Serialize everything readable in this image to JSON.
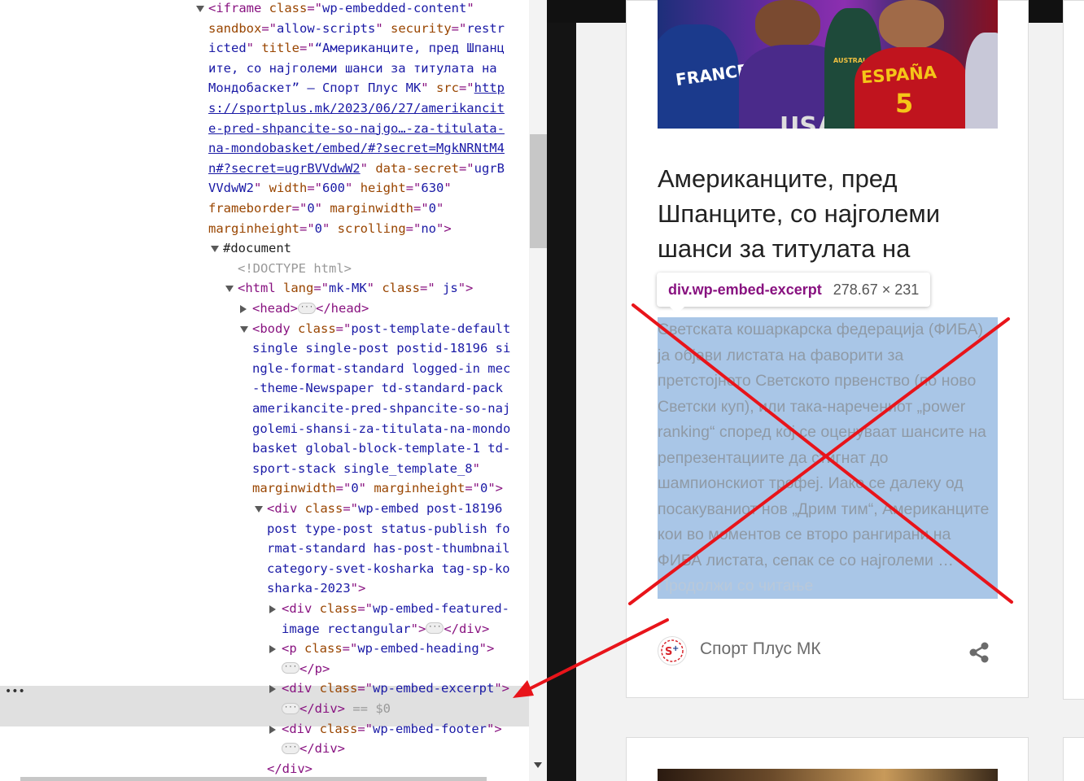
{
  "devtools": {
    "lines": [
      {
        "indent": 256,
        "tri": "down",
        "parts": [
          [
            "tag",
            "<iframe "
          ],
          [
            "an",
            "class"
          ],
          [
            "tag",
            "=\""
          ],
          [
            "av",
            "wp-embedded-content"
          ],
          [
            "tag",
            "\""
          ]
        ]
      },
      {
        "indent": 256,
        "parts": [
          [
            "an",
            "sandbox"
          ],
          [
            "tag",
            "=\""
          ],
          [
            "av",
            "allow-scripts"
          ],
          [
            "tag",
            "\" "
          ],
          [
            "an",
            "security"
          ],
          [
            "tag",
            "=\""
          ],
          [
            "av",
            "restr"
          ]
        ]
      },
      {
        "indent": 256,
        "parts": [
          [
            "av",
            "icted"
          ],
          [
            "tag",
            "\" "
          ],
          [
            "an",
            "title"
          ],
          [
            "tag",
            "=\""
          ],
          [
            "av",
            "“Американците, пред Шпанц"
          ]
        ]
      },
      {
        "indent": 256,
        "parts": [
          [
            "av",
            "ите, со најголеми шанси за титулата на"
          ]
        ]
      },
      {
        "indent": 256,
        "parts": [
          [
            "av",
            "Мондобаскет” — Спорт Плус МК"
          ],
          [
            "tag",
            "\" "
          ],
          [
            "an",
            "src"
          ],
          [
            "tag",
            "=\""
          ],
          [
            "link",
            "http"
          ]
        ]
      },
      {
        "indent": 256,
        "parts": [
          [
            "link",
            "s://sportplus.mk/2023/06/27/amerikancit"
          ]
        ]
      },
      {
        "indent": 256,
        "parts": [
          [
            "link",
            "e-pred-shpancite-so-najgo…-za-titulata-"
          ]
        ]
      },
      {
        "indent": 256,
        "parts": [
          [
            "link",
            "na-mondobasket/embed/#?secret=MgkNRNtM4"
          ]
        ]
      },
      {
        "indent": 256,
        "parts": [
          [
            "link",
            "n#?secret=ugrBVVdwW2"
          ],
          [
            "tag",
            "\" "
          ],
          [
            "an",
            "data-secret"
          ],
          [
            "tag",
            "=\""
          ],
          [
            "av",
            "ugrB"
          ]
        ]
      },
      {
        "indent": 256,
        "parts": [
          [
            "av",
            "VVdwW2"
          ],
          [
            "tag",
            "\" "
          ],
          [
            "an",
            "width"
          ],
          [
            "tag",
            "=\""
          ],
          [
            "av",
            "600"
          ],
          [
            "tag",
            "\" "
          ],
          [
            "an",
            "height"
          ],
          [
            "tag",
            "=\""
          ],
          [
            "av",
            "630"
          ],
          [
            "tag",
            "\""
          ]
        ]
      },
      {
        "indent": 256,
        "parts": [
          [
            "an",
            "frameborder"
          ],
          [
            "tag",
            "=\""
          ],
          [
            "av",
            "0"
          ],
          [
            "tag",
            "\" "
          ],
          [
            "an",
            "marginwidth"
          ],
          [
            "tag",
            "=\""
          ],
          [
            "av",
            "0"
          ],
          [
            "tag",
            "\""
          ]
        ]
      },
      {
        "indent": 256,
        "parts": [
          [
            "an",
            "marginheight"
          ],
          [
            "tag",
            "=\""
          ],
          [
            "av",
            "0"
          ],
          [
            "tag",
            "\" "
          ],
          [
            "an",
            "scrolling"
          ],
          [
            "tag",
            "=\""
          ],
          [
            "av",
            "no"
          ],
          [
            "tag",
            "\">"
          ]
        ]
      },
      {
        "indent": 274,
        "tri": "down",
        "parts": [
          [
            "plain",
            "#document"
          ]
        ]
      },
      {
        "indent": 292,
        "parts": [
          [
            "gray",
            "<!DOCTYPE html>"
          ]
        ]
      },
      {
        "indent": 292,
        "tri": "down",
        "parts": [
          [
            "tag",
            "<html "
          ],
          [
            "an",
            "lang"
          ],
          [
            "tag",
            "=\""
          ],
          [
            "av",
            "mk-MK"
          ],
          [
            "tag",
            "\" "
          ],
          [
            "an",
            "class"
          ],
          [
            "tag",
            "=\""
          ],
          [
            "av",
            " js"
          ],
          [
            "tag",
            "\">"
          ]
        ]
      },
      {
        "indent": 310,
        "tri": "right",
        "parts": [
          [
            "tag",
            "<head>"
          ],
          [
            "ell",
            ""
          ],
          [
            "tag",
            "</head>"
          ]
        ]
      },
      {
        "indent": 310,
        "tri": "down",
        "parts": [
          [
            "tag",
            "<body "
          ],
          [
            "an",
            "class"
          ],
          [
            "tag",
            "=\""
          ],
          [
            "av",
            "post-template-default"
          ]
        ]
      },
      {
        "indent": 310,
        "parts": [
          [
            "av",
            "single single-post postid-18196 si"
          ]
        ]
      },
      {
        "indent": 310,
        "parts": [
          [
            "av",
            "ngle-format-standard logged-in mec"
          ]
        ]
      },
      {
        "indent": 310,
        "parts": [
          [
            "av",
            "-theme-Newspaper td-standard-pack"
          ]
        ]
      },
      {
        "indent": 310,
        "parts": [
          [
            "av",
            "amerikancite-pred-shpancite-so-naj"
          ]
        ]
      },
      {
        "indent": 310,
        "parts": [
          [
            "av",
            "golemi-shansi-za-titulata-na-mondo"
          ]
        ]
      },
      {
        "indent": 310,
        "parts": [
          [
            "av",
            "basket global-block-template-1 td-"
          ]
        ]
      },
      {
        "indent": 310,
        "parts": [
          [
            "av",
            "sport-stack single_template_8"
          ],
          [
            "tag",
            "\""
          ]
        ]
      },
      {
        "indent": 310,
        "parts": [
          [
            "an",
            "marginwidth"
          ],
          [
            "tag",
            "=\""
          ],
          [
            "av",
            "0"
          ],
          [
            "tag",
            "\" "
          ],
          [
            "an",
            "marginheight"
          ],
          [
            "tag",
            "=\""
          ],
          [
            "av",
            "0"
          ],
          [
            "tag",
            "\">"
          ]
        ]
      },
      {
        "indent": 328,
        "tri": "down",
        "parts": [
          [
            "tag",
            "<div "
          ],
          [
            "an",
            "class"
          ],
          [
            "tag",
            "=\""
          ],
          [
            "av",
            "wp-embed post-18196"
          ]
        ]
      },
      {
        "indent": 328,
        "parts": [
          [
            "av",
            "post type-post status-publish fo"
          ]
        ]
      },
      {
        "indent": 328,
        "parts": [
          [
            "av",
            "rmat-standard has-post-thumbnail"
          ]
        ]
      },
      {
        "indent": 328,
        "parts": [
          [
            "av",
            "category-svet-kosharka tag-sp-ko"
          ]
        ]
      },
      {
        "indent": 328,
        "parts": [
          [
            "av",
            "sharka-2023"
          ],
          [
            "tag",
            "\">"
          ]
        ]
      },
      {
        "indent": 346,
        "tri": "right",
        "parts": [
          [
            "tag",
            "<div "
          ],
          [
            "an",
            "class"
          ],
          [
            "tag",
            "=\""
          ],
          [
            "av",
            "wp-embed-featured-"
          ]
        ]
      },
      {
        "indent": 346,
        "parts": [
          [
            "av",
            "image rectangular"
          ],
          [
            "tag",
            "\">"
          ],
          [
            "ell",
            ""
          ],
          [
            "tag",
            "</div>"
          ]
        ]
      },
      {
        "indent": 346,
        "tri": "right",
        "parts": [
          [
            "tag",
            "<p "
          ],
          [
            "an",
            "class"
          ],
          [
            "tag",
            "=\""
          ],
          [
            "av",
            "wp-embed-heading"
          ],
          [
            "tag",
            "\">"
          ]
        ]
      },
      {
        "indent": 346,
        "parts": [
          [
            "ell",
            ""
          ],
          [
            "tag",
            "</p>"
          ]
        ]
      },
      {
        "indent": 346,
        "tri": "right",
        "parts": [
          [
            "tag",
            "<div "
          ],
          [
            "an",
            "class"
          ],
          [
            "tag",
            "=\""
          ],
          [
            "av",
            "wp-embed-excerpt"
          ],
          [
            "tag",
            "\">"
          ]
        ]
      },
      {
        "indent": 346,
        "parts": [
          [
            "ell",
            ""
          ],
          [
            "tag",
            "</div>"
          ],
          [
            "gray",
            " == "
          ],
          [
            "gray",
            "$0"
          ]
        ]
      },
      {
        "indent": 346,
        "tri": "right",
        "parts": [
          [
            "tag",
            "<div "
          ],
          [
            "an",
            "class"
          ],
          [
            "tag",
            "=\""
          ],
          [
            "av",
            "wp-embed-footer"
          ],
          [
            "tag",
            "\">"
          ]
        ]
      },
      {
        "indent": 346,
        "parts": [
          [
            "ell",
            ""
          ],
          [
            "tag",
            "</div>"
          ]
        ]
      },
      {
        "indent": 328,
        "parts": [
          [
            "tag",
            "</div>"
          ]
        ]
      }
    ],
    "selected_dots": "•••"
  },
  "page": {
    "featured_texts": {
      "france": "FRANCE",
      "usa": "USA",
      "australia": "AUSTRALIA",
      "espana": "ESPAÑA",
      "number": "5"
    },
    "headline": "Американците, пред Шпанците, со најголеми шанси за титулата на",
    "excerpt": "Светската кошаркарска федерација (ФИБА) ја објави листата на фаворити за претстојното Светското првенство (по ново Светски куп), или така-наречениот „power ranking“ според кој се оценуваат шансите на репрезентациите да стигнат до шампионскиот трофеј.  Иако се далеку од посакуваниот нов „Дрим тим“, Американците кои во моментов се второ рангирани на ФИБА листата, сепак се со најголеми …",
    "read_more": "Продолжи со читање",
    "site_name": "Спорт Плус МК",
    "tooltip": {
      "selector": "div.wp-embed-excerpt",
      "dimensions": "278.67 × 231"
    }
  },
  "colors": {
    "annotation": "#e8141a",
    "highlight": "#a9c6e7",
    "tag": "#881280"
  }
}
